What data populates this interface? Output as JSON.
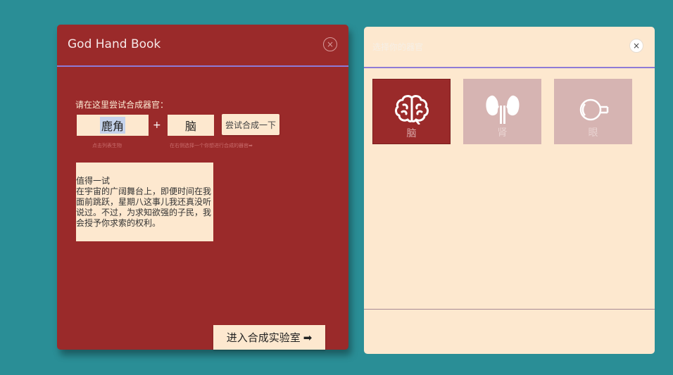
{
  "left_panel": {
    "title": "God Hand Book",
    "close_glyph": "×",
    "prompt": "请在这里尝试合成器官：",
    "ingredient1": "鹿角",
    "plus": "+",
    "ingredient2": "脑",
    "try_button": "尝试合成一下",
    "hint1": "点击列表生物",
    "hint2": "在右侧选择一个你想进行合成的器官➡",
    "result_title": "值得一试",
    "result_text": "在宇宙的广阔舞台上，即便时间在我面前跳跃，星期八这事儿我还真没听说过。不过，为求知欲强的子民，我会授予你求索的权利。",
    "lab_button": "进入合成实验室",
    "lab_arrow": "➡"
  },
  "right_panel": {
    "title": "选择你的器官",
    "close_glyph": "×",
    "organs": [
      {
        "label": "脑",
        "icon": "brain-icon",
        "selected": true
      },
      {
        "label": "肾",
        "icon": "kidney-icon",
        "selected": false
      },
      {
        "label": "眼",
        "icon": "eye-icon",
        "selected": false
      }
    ]
  },
  "colors": {
    "background": "#2a8e96",
    "panel_red": "#9a2a2a",
    "panel_cream": "#fde8cf",
    "divider": "#8e7bd6"
  }
}
